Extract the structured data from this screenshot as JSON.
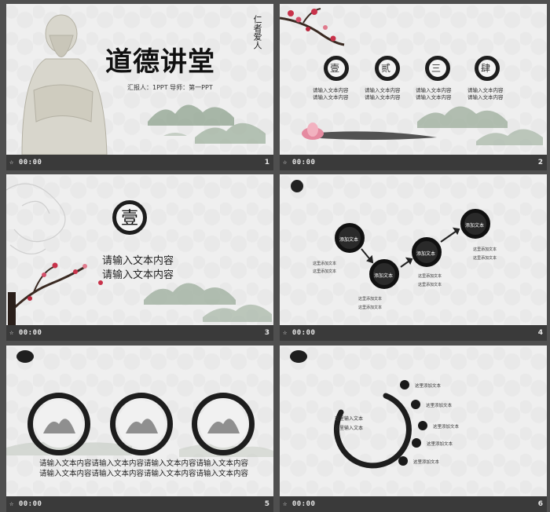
{
  "time_label": "00:00",
  "slides": [
    {
      "number": "1",
      "title": "道德讲堂",
      "vertical": "仁者爱人",
      "subtitle": "汇报人：1PPT   导师：第一PPT"
    },
    {
      "number": "2",
      "circles": [
        "壹",
        "贰",
        "三",
        "肆"
      ],
      "text_line": "请输入文本内容"
    },
    {
      "number": "3",
      "circle_char": "壹",
      "lines": [
        "请输入文本内容",
        "请输入文本内容"
      ]
    },
    {
      "number": "4",
      "nodes": [
        "添加文本",
        "添加文本",
        "添加文本",
        "添加文本"
      ],
      "small_text": "这里添加文本"
    },
    {
      "number": "5",
      "lines": [
        "请输入文本内容请输入文本内容请输入文本内容请输入文本内容",
        "请输入文本内容请输入文本内容请输入文本内容请输入文本内容"
      ]
    },
    {
      "number": "6",
      "ring_lines": [
        "这里输入文本",
        "这里输入文本"
      ],
      "items": [
        "这里添加文本",
        "这里添加文本",
        "这里添加文本",
        "这里添加文本",
        "这里添加文本"
      ]
    }
  ]
}
